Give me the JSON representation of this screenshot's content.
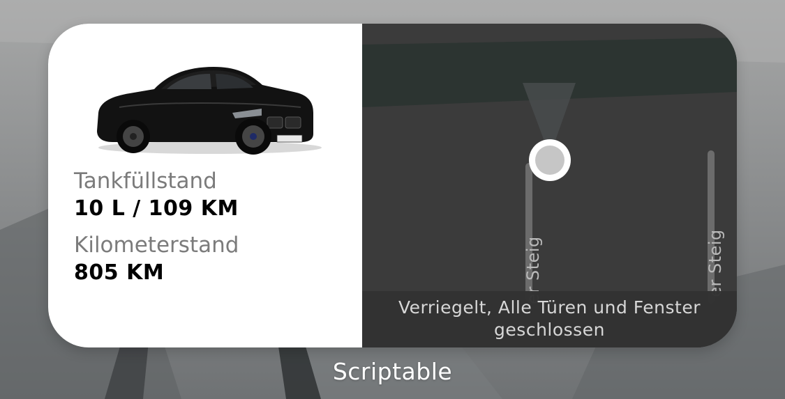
{
  "widget": {
    "car_image_alt": "car-image",
    "fuel_label": "Tankfüllstand",
    "fuel_value": "10 L / 109 KM",
    "odometer_label": "Kilometerstand",
    "odometer_value": "805 KM",
    "map": {
      "street_label_1": "er Steig",
      "street_label_2": "er Steig",
      "location_pin_icon": "location-dot-icon"
    },
    "status_text": "Verriegelt, Alle Türen und Fenster geschlossen"
  },
  "app_name": "Scriptable",
  "colors": {
    "map_background": "#3b3b3b",
    "map_band": "#2c3431",
    "status_bar": "#323232",
    "label_gray": "#7b7b7b"
  }
}
